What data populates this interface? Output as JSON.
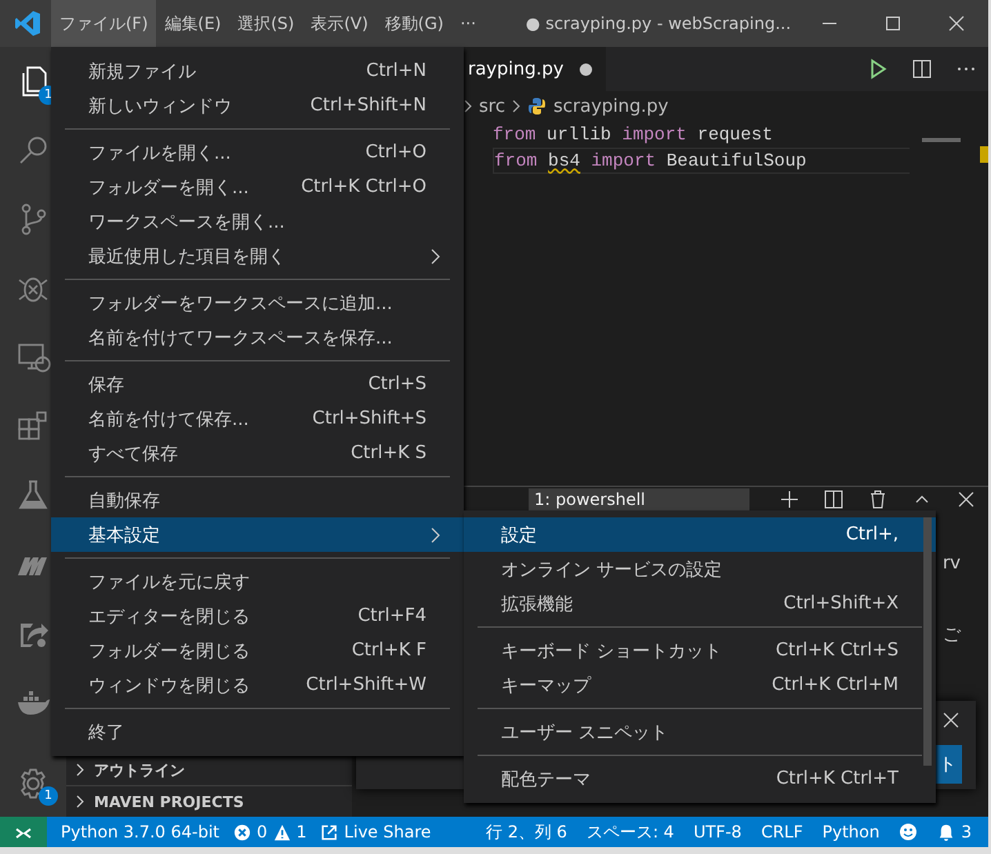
{
  "title_bar": {
    "menus": [
      {
        "label": "ファイル(F)",
        "selected": true
      },
      {
        "label": "編集(E)",
        "selected": false
      },
      {
        "label": "選択(S)",
        "selected": false
      },
      {
        "label": "表示(V)",
        "selected": false
      },
      {
        "label": "移動(G)",
        "selected": false
      },
      {
        "label": "···",
        "selected": false
      }
    ],
    "title": "● scrayping.py - webScraping..."
  },
  "activity_bar": {
    "items": [
      {
        "kind": "files",
        "selected": true,
        "badge": "1"
      },
      {
        "kind": "search",
        "selected": false
      },
      {
        "kind": "source-control",
        "selected": false
      },
      {
        "kind": "debug",
        "selected": false
      },
      {
        "kind": "remote",
        "selected": false
      },
      {
        "kind": "extensions",
        "selected": false
      },
      {
        "kind": "flask",
        "selected": false
      },
      {
        "kind": "logo-m",
        "selected": false
      },
      {
        "kind": "share",
        "selected": false
      },
      {
        "kind": "docker",
        "selected": false
      }
    ],
    "settings_badge": "1"
  },
  "sidebar": {
    "sections": [
      {
        "label": "アウトライン",
        "expanded": false
      },
      {
        "label": "MAVEN PROJECTS",
        "expanded": false
      }
    ]
  },
  "editor": {
    "tab": {
      "label": "rayping.py",
      "dirty": true
    },
    "breadcrumb": [
      "src",
      "scrayping.py"
    ],
    "lines": [
      {
        "current": false,
        "tokens": [
          {
            "text": "from",
            "kind": "keyword"
          },
          {
            "text": "urllib",
            "kind": "plain"
          },
          {
            "text": "import",
            "kind": "keyword"
          },
          {
            "text": "request",
            "kind": "plain"
          }
        ]
      },
      {
        "current": true,
        "tokens": [
          {
            "text": "from",
            "kind": "keyword"
          },
          {
            "text": "bs4",
            "kind": "plain",
            "warning": true
          },
          {
            "text": "import",
            "kind": "keyword"
          },
          {
            "text": "BeautifulSoup",
            "kind": "plain"
          }
        ]
      }
    ]
  },
  "terminal": {
    "dropdown": "1: powershell",
    "fragments": [
      "rv",
      "ご"
    ]
  },
  "notification": {
    "button": "ト"
  },
  "file_menu": {
    "groups": [
      {
        "items": [
          {
            "label": "新規ファイル",
            "shortcut": "Ctrl+N",
            "submenu": false,
            "selected": false
          },
          {
            "label": "新しいウィンドウ",
            "shortcut": "Ctrl+Shift+N",
            "submenu": false,
            "selected": false
          }
        ]
      },
      {
        "items": [
          {
            "label": "ファイルを開く...",
            "shortcut": "Ctrl+O",
            "submenu": false,
            "selected": false
          },
          {
            "label": "フォルダーを開く...",
            "shortcut": "Ctrl+K Ctrl+O",
            "submenu": false,
            "selected": false
          },
          {
            "label": "ワークスペースを開く...",
            "submenu": false,
            "selected": false
          },
          {
            "label": "最近使用した項目を開く",
            "submenu": true,
            "selected": false
          }
        ]
      },
      {
        "items": [
          {
            "label": "フォルダーをワークスペースに追加...",
            "submenu": false,
            "selected": false
          },
          {
            "label": "名前を付けてワークスペースを保存...",
            "submenu": false,
            "selected": false
          }
        ]
      },
      {
        "items": [
          {
            "label": "保存",
            "shortcut": "Ctrl+S",
            "submenu": false,
            "selected": false
          },
          {
            "label": "名前を付けて保存...",
            "shortcut": "Ctrl+Shift+S",
            "submenu": false,
            "selected": false
          },
          {
            "label": "すべて保存",
            "shortcut": "Ctrl+K S",
            "submenu": false,
            "selected": false
          }
        ]
      },
      {
        "items": [
          {
            "label": "自動保存",
            "submenu": false,
            "selected": false
          },
          {
            "label": "基本設定",
            "submenu": true,
            "selected": true
          }
        ]
      },
      {
        "items": [
          {
            "label": "ファイルを元に戻す",
            "submenu": false,
            "selected": false
          },
          {
            "label": "エディターを閉じる",
            "shortcut": "Ctrl+F4",
            "submenu": false,
            "selected": false
          },
          {
            "label": "フォルダーを閉じる",
            "shortcut": "Ctrl+K F",
            "submenu": false,
            "selected": false
          },
          {
            "label": "ウィンドウを閉じる",
            "shortcut": "Ctrl+Shift+W",
            "submenu": false,
            "selected": false
          }
        ]
      },
      {
        "items": [
          {
            "label": "終了",
            "submenu": false,
            "selected": false
          }
        ]
      }
    ]
  },
  "preferences_menu": {
    "groups": [
      {
        "items": [
          {
            "label": "設定",
            "shortcut": "Ctrl+,",
            "submenu": false,
            "selected": true
          },
          {
            "label": "オンライン サービスの設定",
            "submenu": false,
            "selected": false
          },
          {
            "label": "拡張機能",
            "shortcut": "Ctrl+Shift+X",
            "submenu": false,
            "selected": false
          }
        ]
      },
      {
        "items": [
          {
            "label": "キーボード ショートカット",
            "shortcut": "Ctrl+K Ctrl+S",
            "submenu": false,
            "selected": false
          },
          {
            "label": "キーマップ",
            "shortcut": "Ctrl+K Ctrl+M",
            "submenu": false,
            "selected": false
          }
        ]
      },
      {
        "items": [
          {
            "label": "ユーザー スニペット",
            "submenu": false,
            "selected": false
          }
        ]
      },
      {
        "items": [
          {
            "label": "配色テーマ",
            "shortcut": "Ctrl+K Ctrl+T",
            "submenu": false,
            "selected": false
          }
        ]
      }
    ]
  },
  "status_bar": {
    "left": [
      {
        "kind": "remote"
      },
      {
        "kind": "text",
        "text": "Python 3.7.0 64-bit"
      },
      {
        "kind": "problems",
        "errors": "0",
        "warnings": "1"
      },
      {
        "kind": "live-share",
        "text": "Live Share"
      }
    ],
    "right": [
      {
        "kind": "text",
        "text": "行 2、列 6"
      },
      {
        "kind": "text",
        "text": "スペース: 4"
      },
      {
        "kind": "text",
        "text": "UTF-8"
      },
      {
        "kind": "text",
        "text": "CRLF"
      },
      {
        "kind": "text",
        "text": "Python"
      },
      {
        "kind": "feedback"
      },
      {
        "kind": "bell",
        "count": "3"
      }
    ]
  }
}
